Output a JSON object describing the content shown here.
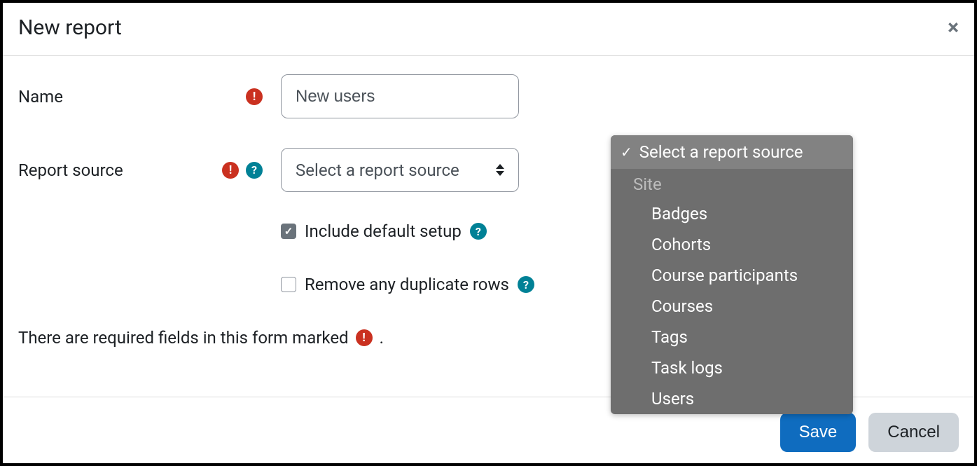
{
  "modal": {
    "title": "New report"
  },
  "form": {
    "name": {
      "label": "Name",
      "value": "New users"
    },
    "source": {
      "label": "Report source",
      "selected": "Select a report source"
    },
    "include_default": {
      "label": "Include default setup",
      "checked": true
    },
    "remove_dupes": {
      "label": "Remove any duplicate rows",
      "checked": false
    },
    "required_note_prefix": "There are required fields in this form marked",
    "required_note_suffix": "."
  },
  "dropdown": {
    "selected_label": "Select a report source",
    "group_label": "Site",
    "options": [
      "Badges",
      "Cohorts",
      "Course participants",
      "Courses",
      "Tags",
      "Task logs",
      "Users"
    ]
  },
  "footer": {
    "save": "Save",
    "cancel": "Cancel"
  }
}
